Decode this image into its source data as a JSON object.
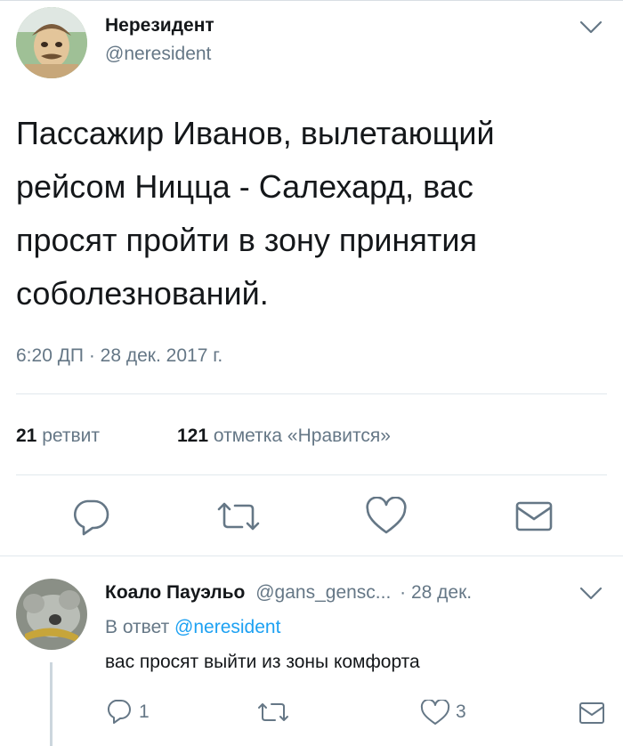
{
  "tweet": {
    "author_name": "Нерезидент",
    "author_handle": "@neresident",
    "text_lines": [
      "Пассажир Иванов, вылетающий",
      "рейсом Ницца - Салехард, вас",
      "просят пройти в зону принятия",
      "соболезнований."
    ],
    "timestamp": "6:20 ДП · 28 дек. 2017 г.",
    "retweets": {
      "count": "21",
      "label": "ретвит"
    },
    "likes": {
      "count": "121",
      "label": "отметка «Нравится»"
    },
    "actions": [
      "reply-icon",
      "retweet-icon",
      "like-icon",
      "dm-icon"
    ]
  },
  "reply": {
    "author_name": "Коало Пауэльо",
    "author_handle": "@gans_gensc...",
    "date": "· 28 дек.",
    "in_reply_prefix": "В ответ",
    "in_reply_handle": "@neresident",
    "text": "вас просят выйти из зоны комфорта",
    "reply_count": "1",
    "like_count": "3"
  },
  "colors": {
    "text": "#14171a",
    "secondary": "#657786",
    "accent": "#1da1f2",
    "divider": "#e1e8ed",
    "icon": "#657786"
  }
}
